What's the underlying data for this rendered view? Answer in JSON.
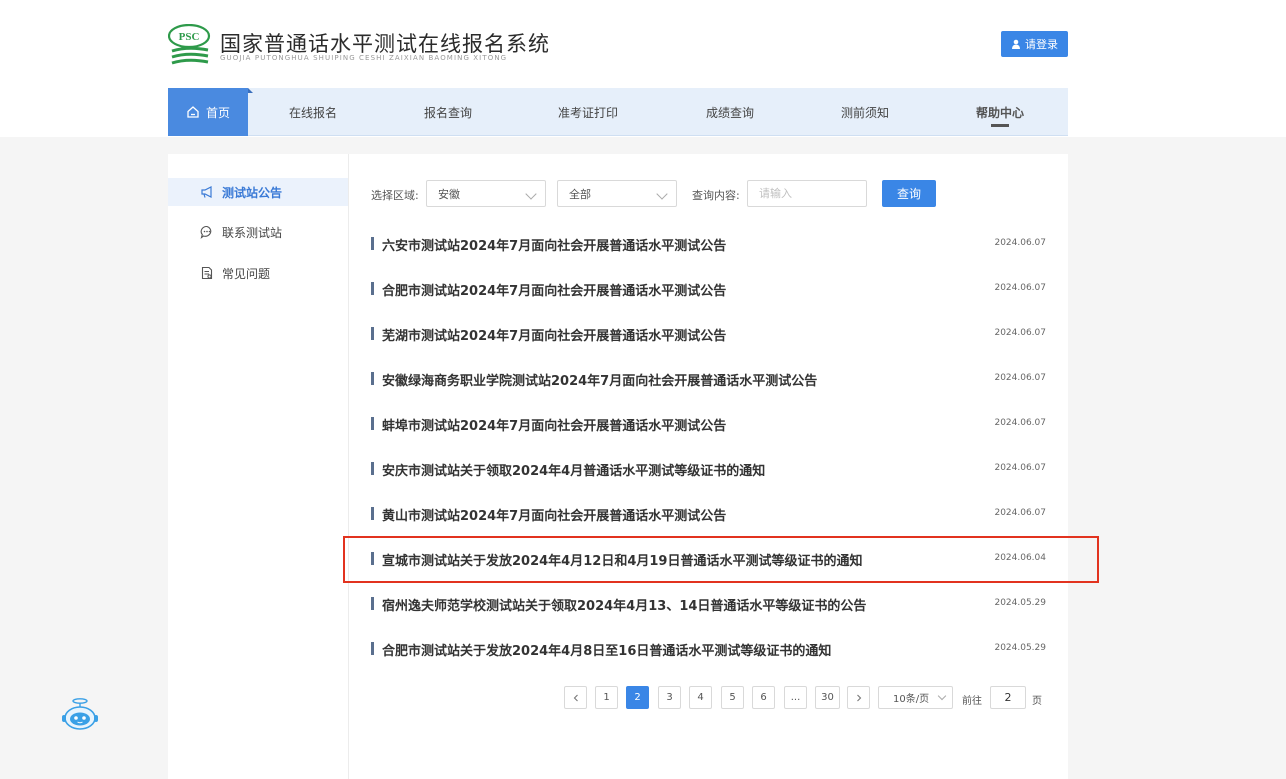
{
  "header": {
    "logo_badge": "PSC",
    "logo_title": "国家普通话水平测试在线报名系统",
    "logo_subtitle": "GUOJIA PUTONGHUA SHUIPING CESHI ZAIXIAN BAOMING XITONG",
    "login_label": "请登录",
    "login_icon": "user-icon"
  },
  "nav": {
    "items": [
      {
        "label": "首页",
        "icon": "home-icon",
        "active": true
      },
      {
        "label": "在线报名"
      },
      {
        "label": "报名查询"
      },
      {
        "label": "准考证打印"
      },
      {
        "label": "成绩查询"
      },
      {
        "label": "测前须知"
      },
      {
        "label": "帮助中心",
        "current_section": true
      }
    ]
  },
  "sidebar": {
    "items": [
      {
        "label": "测试站公告",
        "icon": "megaphone-icon",
        "active": true
      },
      {
        "label": "联系测试站",
        "icon": "chat-icon"
      },
      {
        "label": "常见问题",
        "icon": "document-icon"
      }
    ]
  },
  "filters": {
    "region_label": "选择区域:",
    "province_value": "安徽",
    "city_value": "全部",
    "query_label": "查询内容:",
    "query_placeholder": "请输入",
    "query_button": "查询"
  },
  "notices": [
    {
      "title": "六安市测试站2024年7月面向社会开展普通话水平测试公告",
      "date": "2024.06.07"
    },
    {
      "title": "合肥市测试站2024年7月面向社会开展普通话水平测试公告",
      "date": "2024.06.07"
    },
    {
      "title": "芜湖市测试站2024年7月面向社会开展普通话水平测试公告",
      "date": "2024.06.07"
    },
    {
      "title": "安徽绿海商务职业学院测试站2024年7月面向社会开展普通话水平测试公告",
      "date": "2024.06.07"
    },
    {
      "title": "蚌埠市测试站2024年7月面向社会开展普通话水平测试公告",
      "date": "2024.06.07"
    },
    {
      "title": "安庆市测试站关于领取2024年4月普通话水平测试等级证书的通知",
      "date": "2024.06.07"
    },
    {
      "title": "黄山市测试站2024年7月面向社会开展普通话水平测试公告",
      "date": "2024.06.07"
    },
    {
      "title": "宣城市测试站关于发放2024年4月12日和4月19日普通话水平测试等级证书的通知",
      "date": "2024.06.04",
      "highlighted": true
    },
    {
      "title": "宿州逸夫师范学校测试站关于领取2024年4月13、14日普通话水平等级证书的公告",
      "date": "2024.05.29"
    },
    {
      "title": "合肥市测试站关于发放2024年4月8日至16日普通话水平测试等级证书的通知",
      "date": "2024.05.29"
    }
  ],
  "pagination": {
    "pages": [
      "1",
      "2",
      "3",
      "4",
      "5",
      "6",
      "...",
      "30"
    ],
    "current_page": "2",
    "page_size": "10条/页",
    "goto_prefix": "前往",
    "goto_value": "2",
    "goto_suffix": "页"
  },
  "colors": {
    "accent": "#3a86e6",
    "nav_bg": "#e6effa",
    "highlight_border": "#e2331f",
    "logo_green": "#2e9a4a"
  },
  "floating": {
    "icon": "robot-assistant-icon"
  }
}
